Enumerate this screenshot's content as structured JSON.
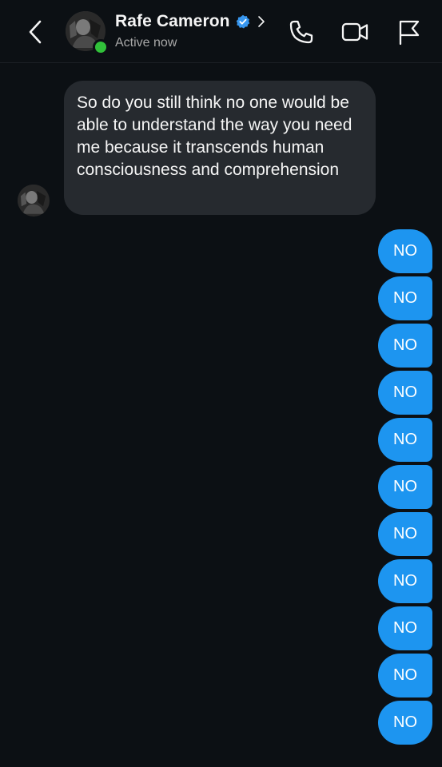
{
  "header": {
    "back_icon": "chevron-left-icon",
    "contact_name": "Rafe Cameron",
    "verified_icon": "verified-badge-icon",
    "status": "Active now",
    "icons": [
      "phone-icon",
      "video-camera-icon",
      "flag-icon"
    ]
  },
  "colors": {
    "background": "#0c1014",
    "incoming_bubble": "#262a2f",
    "outgoing_bubble": "#1d95f0",
    "verified": "#3797f0",
    "online": "#31c13a"
  },
  "messages": [
    {
      "direction": "incoming",
      "text": "So do you still think no one would be able to understand the way you need me because it transcends human consciousness and comprehension"
    },
    {
      "direction": "outgoing",
      "text": "NO"
    },
    {
      "direction": "outgoing",
      "text": "NO"
    },
    {
      "direction": "outgoing",
      "text": "NO"
    },
    {
      "direction": "outgoing",
      "text": "NO"
    },
    {
      "direction": "outgoing",
      "text": "NO"
    },
    {
      "direction": "outgoing",
      "text": "NO"
    },
    {
      "direction": "outgoing",
      "text": "NO"
    },
    {
      "direction": "outgoing",
      "text": "NO"
    },
    {
      "direction": "outgoing",
      "text": "NO"
    },
    {
      "direction": "outgoing",
      "text": "NO"
    },
    {
      "direction": "outgoing",
      "text": "NO"
    }
  ]
}
